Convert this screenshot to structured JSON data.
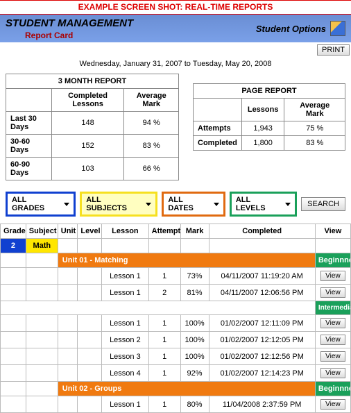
{
  "banner": "EXAMPLE SCREEN SHOT: REAL-TIME REPORTS",
  "header": {
    "title": "STUDENT MANAGEMENT",
    "subtitle": "Report Card",
    "options": "Student Options",
    "print": "PRINT"
  },
  "date_range": "Wednesday, January 31, 2007 to Tuesday, May 20, 2008",
  "month_report": {
    "title": "3 MONTH REPORT",
    "col1": "Completed Lessons",
    "col2": "Average Mark",
    "rows": [
      {
        "label": "Last 30 Days",
        "lessons": "148",
        "mark": "94 %"
      },
      {
        "label": "30-60 Days",
        "lessons": "152",
        "mark": "83 %"
      },
      {
        "label": "60-90 Days",
        "lessons": "103",
        "mark": "66 %"
      }
    ]
  },
  "page_report": {
    "title": "PAGE REPORT",
    "col1": "Lessons",
    "col2": "Average Mark",
    "rows": [
      {
        "label": "Attempts",
        "lessons": "1,943",
        "mark": "75 %"
      },
      {
        "label": "Completed",
        "lessons": "1,800",
        "mark": "83 %"
      }
    ]
  },
  "filters": {
    "grades": "ALL GRADES",
    "subjects": "ALL SUBJECTS",
    "dates": "ALL DATES",
    "levels": "ALL LEVELS",
    "search": "SEARCH"
  },
  "grid": {
    "headers": {
      "grade": "Grade",
      "subject": "Subject",
      "unit": "Unit",
      "level": "Level",
      "lesson": "Lesson",
      "attempt": "Attempt",
      "mark": "Mark",
      "completed": "Completed",
      "view": "View"
    },
    "grade_value": "2",
    "subject_value": "Math",
    "unit1": "Unit 01 - Matching",
    "unit2": "Unit 02 - Groups",
    "level_beginner": "Beginnner",
    "level_intermediate": "Intermediate",
    "view_label": "View",
    "rows_a": [
      {
        "lesson": "Lesson 1",
        "attempt": "1",
        "mark": "73%",
        "completed": "04/11/2007 11:19:20 AM"
      },
      {
        "lesson": "Lesson 1",
        "attempt": "2",
        "mark": "81%",
        "completed": "04/11/2007 12:06:56 PM"
      }
    ],
    "rows_b": [
      {
        "lesson": "Lesson 1",
        "attempt": "1",
        "mark": "100%",
        "completed": "01/02/2007 12:11:09 PM"
      },
      {
        "lesson": "Lesson 2",
        "attempt": "1",
        "mark": "100%",
        "completed": "01/02/2007 12:12:05 PM"
      },
      {
        "lesson": "Lesson 3",
        "attempt": "1",
        "mark": "100%",
        "completed": "01/02/2007 12:12:56 PM"
      },
      {
        "lesson": "Lesson 4",
        "attempt": "1",
        "mark": "92%",
        "completed": "01/02/2007 12:14:23 PM"
      }
    ],
    "rows_c": [
      {
        "lesson": "Lesson 1",
        "attempt": "1",
        "mark": "80%",
        "completed": "11/04/2008 2:37:59 PM"
      }
    ]
  }
}
